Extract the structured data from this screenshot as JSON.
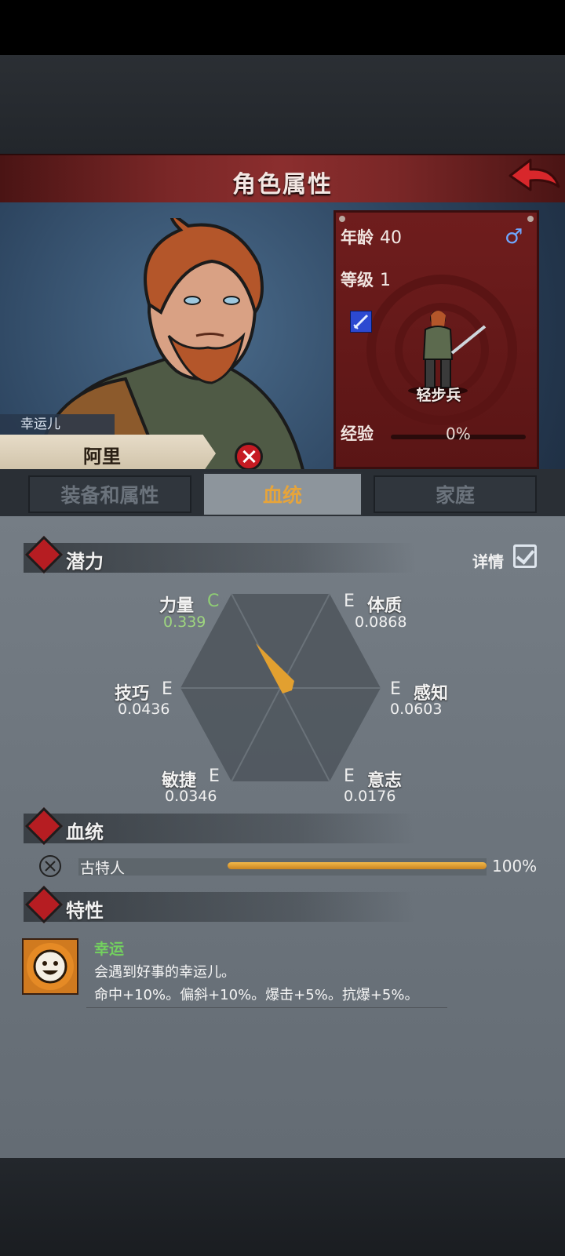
{
  "header": {
    "title": "角色属性"
  },
  "character": {
    "title_tag": "幸运儿",
    "name": "阿里"
  },
  "stats_card": {
    "age_label": "年龄",
    "age_value": "40",
    "level_label": "等级",
    "level_value": "1",
    "unit_class": "轻步兵",
    "exp_label": "经验",
    "exp_value": "0%",
    "gender_icon": "male-icon"
  },
  "tabs": [
    {
      "label": "装备和属性",
      "active": false
    },
    {
      "label": "血统",
      "active": true
    },
    {
      "label": "家庭",
      "active": false
    }
  ],
  "potential": {
    "section_label": "潜力",
    "details_label": "详情",
    "details_checked": true,
    "attributes": {
      "strength": {
        "name": "力量",
        "grade": "C",
        "value": "0.339"
      },
      "constitution": {
        "name": "体质",
        "grade": "E",
        "value": "0.0868"
      },
      "skill": {
        "name": "技巧",
        "grade": "E",
        "value": "0.0436"
      },
      "perception": {
        "name": "感知",
        "grade": "E",
        "value": "0.0603"
      },
      "agility": {
        "name": "敏捷",
        "grade": "E",
        "value": "0.0346"
      },
      "will": {
        "name": "意志",
        "grade": "E",
        "value": "0.0176"
      }
    }
  },
  "bloodline": {
    "section_label": "血统",
    "entries": [
      {
        "name": "古特人",
        "percent": "100%",
        "fraction": 1.0
      }
    ]
  },
  "traits": {
    "section_label": "特性",
    "items": [
      {
        "name": "幸运",
        "description": "会遇到好事的幸运儿。",
        "effect": "命中+10%。偏斜+10%。爆击+5%。抗爆+5%。"
      }
    ]
  },
  "colors": {
    "header_red": "#8b2e2e",
    "card_red": "#6f1d1d",
    "active_tab_text": "#e6a43b",
    "grade_c_green": "#8fcd74",
    "trait_name_green": "#73d05f",
    "bloodline_bar": "#e0a23a"
  }
}
